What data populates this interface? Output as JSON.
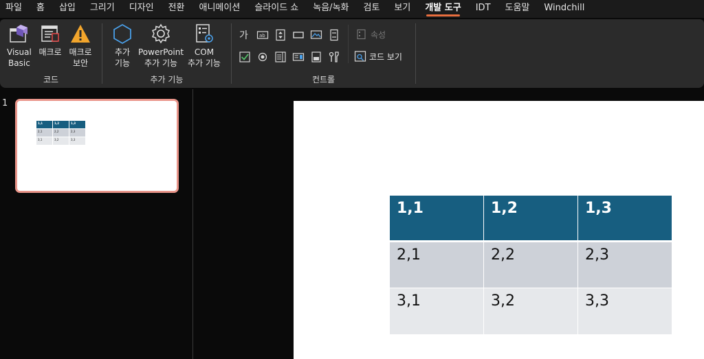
{
  "menu": {
    "tabs": [
      "파일",
      "홈",
      "삽입",
      "그리기",
      "디자인",
      "전환",
      "애니메이션",
      "슬라이드 쇼",
      "녹음/녹화",
      "검토",
      "보기",
      "개발 도구",
      "IDT",
      "도움말",
      "Windchill"
    ],
    "active_tab": "개발 도구"
  },
  "ribbon": {
    "code_group": {
      "label": "코드",
      "visual_basic_line1": "Visual",
      "visual_basic_line2": "Basic",
      "macro": "매크로",
      "macro_security_line1": "매크로",
      "macro_security_line2": "보안"
    },
    "addins_group": {
      "label": "추가 기능",
      "addins_line1": "추가",
      "addins_line2": "기능",
      "ppt_addins_line1": "PowerPoint",
      "ppt_addins_line2": "추가 기능",
      "com_addins_line1": "COM",
      "com_addins_line2": "추가 기능"
    },
    "controls_group": {
      "label": "컨트롤",
      "properties": "속성",
      "view_code": "코드 보기"
    }
  },
  "slides_panel": {
    "slide_number": "1"
  },
  "table": {
    "rows": [
      [
        "1,1",
        "1,2",
        "1,3"
      ],
      [
        "2,1",
        "2,2",
        "2,3"
      ],
      [
        "3,1",
        "3,2",
        "3,3"
      ]
    ]
  },
  "colors": {
    "header_fill": "#175e80",
    "row1_fill": "#cdd1d8",
    "row2_fill": "#e6e8eb",
    "active_tab_underline": "#e96e3e",
    "thumb_border": "#e9958a"
  }
}
